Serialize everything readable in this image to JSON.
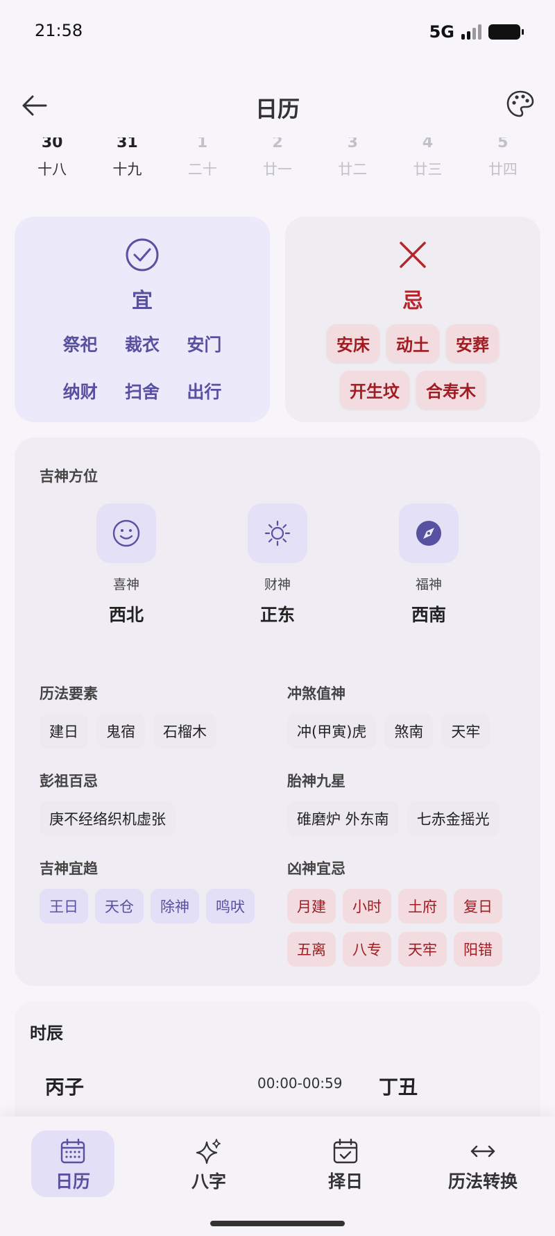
{
  "status_bar": {
    "time": "21:58",
    "network": "5G"
  },
  "header": {
    "title": "日历"
  },
  "date_strip": [
    {
      "day": "30",
      "lunar": "十八",
      "faded": false
    },
    {
      "day": "31",
      "lunar": "十九",
      "faded": false
    },
    {
      "day": "1",
      "lunar": "二十",
      "faded": true
    },
    {
      "day": "2",
      "lunar": "廿一",
      "faded": true
    },
    {
      "day": "3",
      "lunar": "廿二",
      "faded": true
    },
    {
      "day": "4",
      "lunar": "廿三",
      "faded": true
    },
    {
      "day": "5",
      "lunar": "廿四",
      "faded": true
    }
  ],
  "yi": {
    "title": "宜",
    "items": [
      "祭祀",
      "裁衣",
      "安门",
      "纳财",
      "扫舍",
      "出行"
    ]
  },
  "ji": {
    "title": "忌",
    "items": [
      "安床",
      "动土",
      "安葬",
      "开生坟",
      "合寿木"
    ]
  },
  "gods": {
    "label": "吉神方位",
    "items": [
      {
        "name": "喜神",
        "direction": "西北",
        "icon": "smile-icon"
      },
      {
        "name": "财神",
        "direction": "正东",
        "icon": "sun-icon"
      },
      {
        "name": "福神",
        "direction": "西南",
        "icon": "compass-icon"
      }
    ]
  },
  "details": {
    "calendar_elements": {
      "label": "历法要素",
      "items": [
        "建日",
        "鬼宿",
        "石榴木"
      ]
    },
    "clash": {
      "label": "冲煞值神",
      "items": [
        "冲(甲寅)虎",
        "煞南",
        "天牢"
      ]
    },
    "pengzu": {
      "label": "彭祖百忌",
      "items": [
        "庚不经络织机虚张"
      ]
    },
    "fetal_god": {
      "label": "胎神九星",
      "items": [
        "碓磨炉 外东南",
        "七赤金摇光"
      ]
    },
    "good_gods": {
      "label": "吉神宜趋",
      "items": [
        "王日",
        "天仓",
        "除神",
        "鸣吠"
      ]
    },
    "bad_gods": {
      "label": "凶神宜忌",
      "items": [
        "月建",
        "小时",
        "土府",
        "复日",
        "五离",
        "八专",
        "天牢",
        "阳错"
      ]
    }
  },
  "hours": {
    "title": "时辰",
    "first": "丙子",
    "time": "00:00-00:59",
    "second": "丁丑"
  },
  "bottom_nav": [
    {
      "label": "日历",
      "icon": "calendar-icon",
      "active": true
    },
    {
      "label": "八字",
      "icon": "sparkle-icon",
      "active": false
    },
    {
      "label": "择日",
      "icon": "calendar-check-icon",
      "active": false
    },
    {
      "label": "历法转换",
      "icon": "swap-arrows-icon",
      "active": false
    }
  ],
  "colors": {
    "accent": "#5850a0",
    "danger": "#b3262d",
    "background": "#f7f5fa"
  }
}
